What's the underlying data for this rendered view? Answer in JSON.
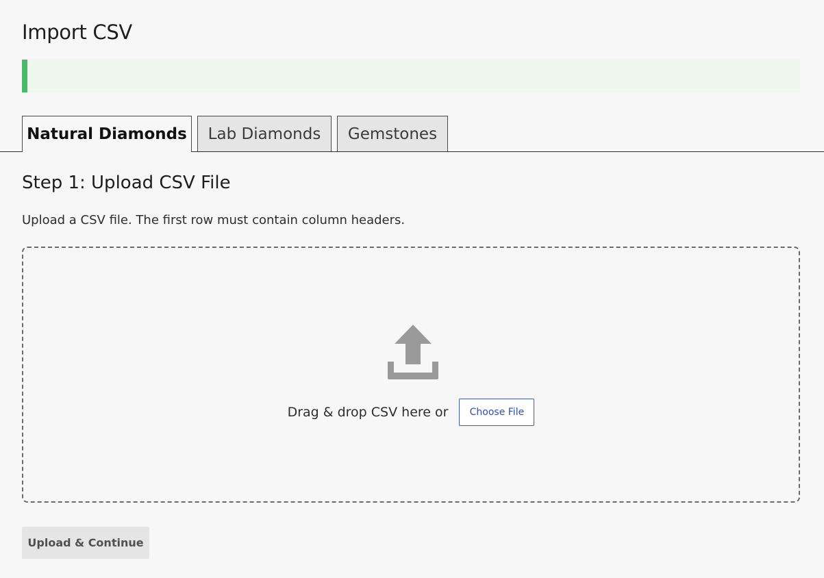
{
  "page": {
    "title": "Import CSV"
  },
  "notice": {
    "text": "",
    "accent_color": "#4ab866",
    "background_color": "#eef8ef"
  },
  "tabs": [
    {
      "label": "Natural Diamonds",
      "active": true
    },
    {
      "label": "Lab Diamonds",
      "active": false
    },
    {
      "label": "Gemstones",
      "active": false
    }
  ],
  "step": {
    "title": "Step 1: Upload CSV File",
    "description": "Upload a CSV file. The first row must contain column headers."
  },
  "dropzone": {
    "icon": "upload-icon",
    "text": "Drag & drop CSV here or",
    "choose_button_label": "Choose File",
    "choose_button_color": "#2f4fa8"
  },
  "submit": {
    "label": "Upload & Continue",
    "disabled": true
  }
}
